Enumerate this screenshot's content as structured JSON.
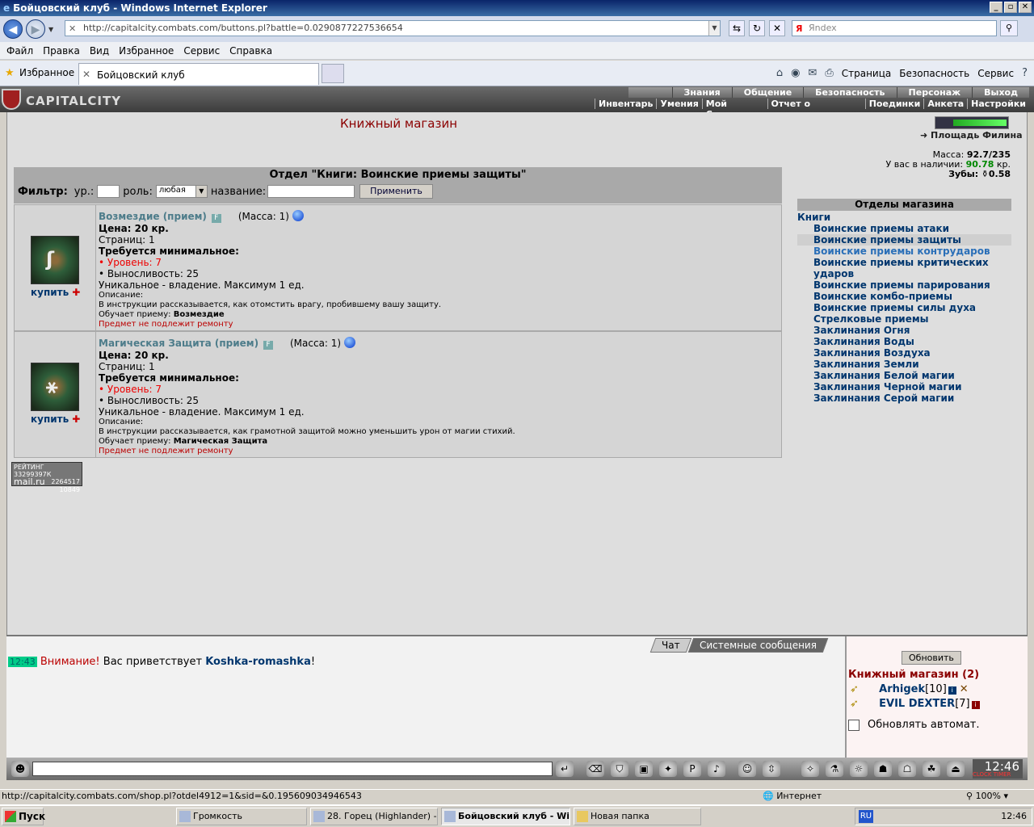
{
  "browser": {
    "window_title": "Бойцовский клуб - Windows Internet Explorer",
    "url": "http://capitalcity.combats.com/buttons.pl?battle=0.0290877227536654",
    "search_placeholder": "Яndex",
    "menu": [
      "Файл",
      "Правка",
      "Вид",
      "Избранное",
      "Сервис",
      "Справка"
    ],
    "favorites_label": "Избранное",
    "tab_title": "Бойцовский клуб",
    "commands": [
      "Страница",
      "Безопасность",
      "Сервис"
    ],
    "status_url": "http://capitalcity.combats.com/shop.pl?otdel4912=1&sid=&0.195609034946543",
    "zone": "Интернет",
    "zoom": "100%"
  },
  "game": {
    "logo": "CAPITALCITY",
    "topnav": [
      "Знания",
      "Общение",
      "Безопасность",
      "Персонаж",
      "Выход"
    ],
    "subnav": [
      "Инвентарь",
      "Умения",
      "Мой Скролл",
      "Отчет о переводах",
      "Поединки",
      "Анкета",
      "Настройки"
    ],
    "shop_title": "Книжный магазин",
    "location_link": "Площадь Филина",
    "stats": {
      "mass_label": "Масса:",
      "mass": "92.7/235",
      "money_label": "У вас в наличии:",
      "money": "90.78",
      "money_unit": "кр.",
      "teeth_label": "Зубы:",
      "teeth": "0.58"
    },
    "department_title": "Отдел \"Книги: Воинские приемы защиты\"",
    "filter": {
      "label": "Фильтр:",
      "level_label": "ур.:",
      "role_label": "роль:",
      "role_value": "любая",
      "name_label": "название:",
      "apply": "Применить"
    },
    "items": [
      {
        "name": "Возмездие (прием)",
        "mass": "(Масса: 1)",
        "price": "Цена: 20 кр.",
        "pages": "Страниц: 1",
        "req": "Требуется минимальное:",
        "level": "• Уровень: 7",
        "endurance": "• Выносливость: 25",
        "unique": "Уникальное - владение. Максимум 1 ед.",
        "desc_label": "Описание:",
        "desc": "В инструкции рассказывается, как отомстить врагу, пробившему вашу защиту.",
        "teaches_label": "Обучает приему:",
        "teaches": "Возмездие",
        "repair": "Предмет не подлежит ремонту",
        "buy": "купить"
      },
      {
        "name": "Магическая Защита (прием)",
        "mass": "(Масса: 1)",
        "price": "Цена: 20 кр.",
        "pages": "Страниц: 1",
        "req": "Требуется минимальное:",
        "level": "• Уровень: 7",
        "endurance": "• Выносливость: 25",
        "unique": "Уникальное - владение. Максимум 1 ед.",
        "desc_label": "Описание:",
        "desc": "В инструкции рассказывается, как грамотной защитой можно уменьшить урон от магии стихий.",
        "teaches_label": "Обучает приему:",
        "teaches": "Магическая Защита",
        "repair": "Предмет не подлежит ремонту",
        "buy": "купить"
      }
    ],
    "counter": {
      "line1": "РЕЙТИНГ 33299397К",
      "logo": "mail.ru",
      "n1": "2264517",
      "n2": "10849"
    },
    "departments_title": "Отделы магазина",
    "books_label": "Книги",
    "departments": [
      "Воинские приемы атаки",
      "Воинские приемы защиты",
      "Воинские приемы контрударов",
      "Воинские приемы критических ударов",
      "Воинские приемы парирования",
      "Воинские комбо-приемы",
      "Воинские приемы силы духа",
      "Стрелковые приемы",
      "Заклинания Огня",
      "Заклинания Воды",
      "Заклинания Воздуха",
      "Заклинания Земли",
      "Заклинания Белой магии",
      "Заклинания Черной магии",
      "Заклинания Серой магии"
    ],
    "chat": {
      "tab_chat": "Чат",
      "tab_system": "Системные сообщения",
      "time": "12:43",
      "warn": "Внимание!",
      "msg": "Вас приветствует",
      "user": "Koshka-romashka",
      "end": "!"
    },
    "users": {
      "refresh": "Обновить",
      "title": "Книжный магазин (2)",
      "list": [
        {
          "name": "Arhigek",
          "level": "[10]"
        },
        {
          "name": "EVIL DEXTER",
          "level": "[7]"
        }
      ],
      "auto": "Обновлять автомат."
    },
    "clock": "12:46",
    "clock_label": "CLOCK  TIMER"
  },
  "taskbar": {
    "start": "Пуск",
    "tasks": [
      "Громкость",
      "28. Горец (Highlander) -...",
      "Бойцовский клуб - Wi...",
      "Новая папка"
    ],
    "lang": "RU",
    "time": "12:46"
  }
}
